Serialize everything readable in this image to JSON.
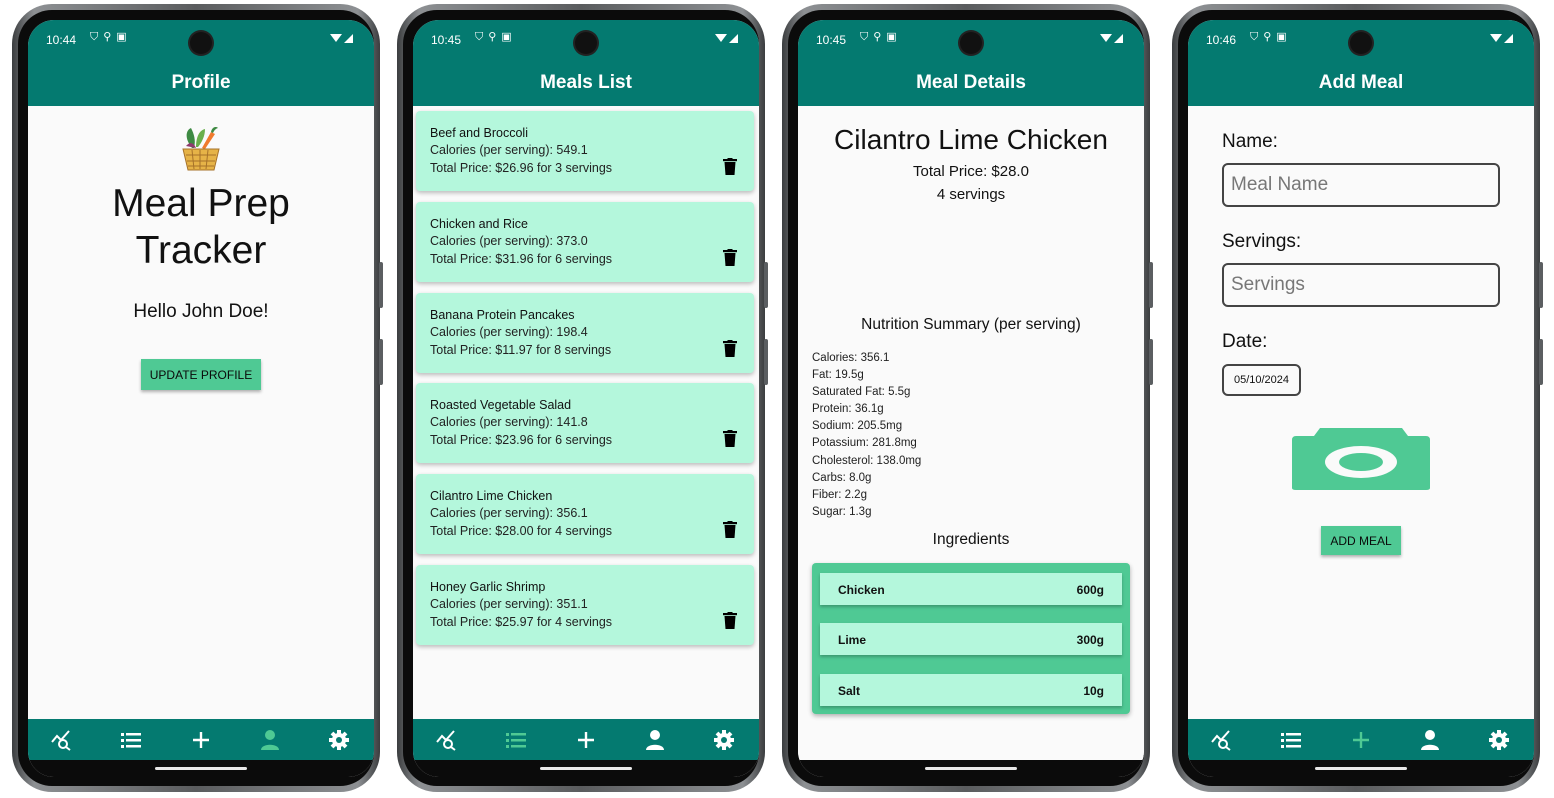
{
  "colors": {
    "header_teal": "#047a70",
    "accent_green": "#4fc994",
    "card_mint": "#b4f7dc",
    "nav_active": "#4fc994",
    "nav_inactive": "#ffffff"
  },
  "nav_icons": [
    "search-chart-icon",
    "list-icon",
    "plus-icon",
    "person-icon",
    "gear-icon"
  ],
  "screens": [
    {
      "time": "10:44",
      "title": "Profile",
      "active_nav": "person-icon",
      "app_name_line1": "Meal Prep",
      "app_name_line2": "Tracker",
      "greeting": "Hello John Doe!",
      "update_button": "UPDATE PROFILE"
    },
    {
      "time": "10:45",
      "title": "Meals List",
      "active_nav": "list-icon",
      "meals": [
        {
          "name": "Beef and Broccoli",
          "calories": "Calories (per serving): 549.1",
          "price": "Total Price: $26.96 for 3 servings"
        },
        {
          "name": "Chicken and Rice",
          "calories": "Calories (per serving): 373.0",
          "price": "Total Price: $31.96 for 6 servings"
        },
        {
          "name": "Banana Protein Pancakes",
          "calories": "Calories (per serving): 198.4",
          "price": "Total Price: $11.97 for 8 servings"
        },
        {
          "name": "Roasted Vegetable Salad",
          "calories": "Calories (per serving): 141.8",
          "price": "Total Price: $23.96 for 6 servings"
        },
        {
          "name": "Cilantro Lime Chicken",
          "calories": "Calories (per serving): 356.1",
          "price": "Total Price: $28.00 for 4 servings"
        },
        {
          "name": "Honey Garlic Shrimp",
          "calories": "Calories (per serving): 351.1",
          "price": "Total Price: $25.97 for 4 servings"
        }
      ]
    },
    {
      "time": "10:45",
      "title": "Meal Details",
      "meal_name": "Cilantro Lime Chicken",
      "total_price": "Total Price: $28.0",
      "servings": "4 servings",
      "nutrition_title": "Nutrition Summary (per serving)",
      "nutrition": [
        "Calories: 356.1",
        "Fat: 19.5g",
        "Saturated Fat: 5.5g",
        "Protein: 36.1g",
        "Sodium: 205.5mg",
        "Potassium: 281.8mg",
        "Cholesterol: 138.0mg",
        "Carbs: 8.0g",
        "Fiber: 2.2g",
        "Sugar: 1.3g"
      ],
      "ingredients_title": "Ingredients",
      "ingredients": [
        {
          "name": "Chicken",
          "qty": "600g"
        },
        {
          "name": "Lime",
          "qty": "300g"
        },
        {
          "name": "Salt",
          "qty": "10g"
        }
      ]
    },
    {
      "time": "10:46",
      "title": "Add Meal",
      "active_nav": "plus-icon",
      "name_label": "Name:",
      "name_placeholder": "Meal Name",
      "servings_label": "Servings:",
      "servings_placeholder": "Servings",
      "date_label": "Date:",
      "date_value": "05/10/2024",
      "add_button": "ADD MEAL"
    }
  ]
}
